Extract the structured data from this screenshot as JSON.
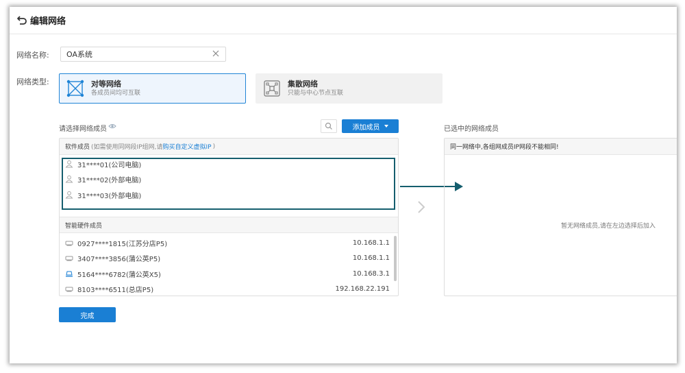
{
  "header": {
    "title": "编辑网络",
    "back_icon": "undo-arrow-icon"
  },
  "form": {
    "name_label": "网络名称:",
    "name_value": "OA系统",
    "type_label": "网络类型:"
  },
  "network_types": [
    {
      "title": "对等网络",
      "desc": "各成员间均可互联",
      "selected": true,
      "icon": "peer-network-icon"
    },
    {
      "title": "集散网络",
      "desc": "只能与中心节点互联",
      "selected": false,
      "icon": "hub-network-icon"
    }
  ],
  "members": {
    "select_label": "请选择网络成员",
    "add_button": "添加成员",
    "software_head": "软件成员",
    "software_hint": "(如需使用同网段IP组网,请",
    "software_hint_link": "购买自定义虚拟IP",
    "software_hint_end": ")",
    "software": [
      {
        "name": "31****01(公司电脑)"
      },
      {
        "name": "31****02(外部电脑)"
      },
      {
        "name": "31****03(外部电脑)"
      }
    ],
    "hardware_head": "智能硬件成员",
    "hardware": [
      {
        "name": "0927****1815(江苏分店P5)",
        "ip": "10.168.1.1",
        "color": "#999999"
      },
      {
        "name": "3407****3856(蒲公英P5)",
        "ip": "10.168.1.1",
        "color": "#999999"
      },
      {
        "name": "5164****6782(蒲公英X5)",
        "ip": "10.168.3.1",
        "color": "#1a7fd4"
      },
      {
        "name": "8103****6511(总店P5)",
        "ip": "192.168.22.191",
        "color": "#999999"
      }
    ]
  },
  "selected": {
    "label": "已选中的网络成员",
    "head": "同一网络中,各组网成员IP网段不能相同!",
    "empty": "暂无网络成员,请在左边选择后加入"
  },
  "footer": {
    "done_button": "完成"
  },
  "colors": {
    "accent": "#1a7fd4",
    "highlight_box": "#155e6e"
  }
}
